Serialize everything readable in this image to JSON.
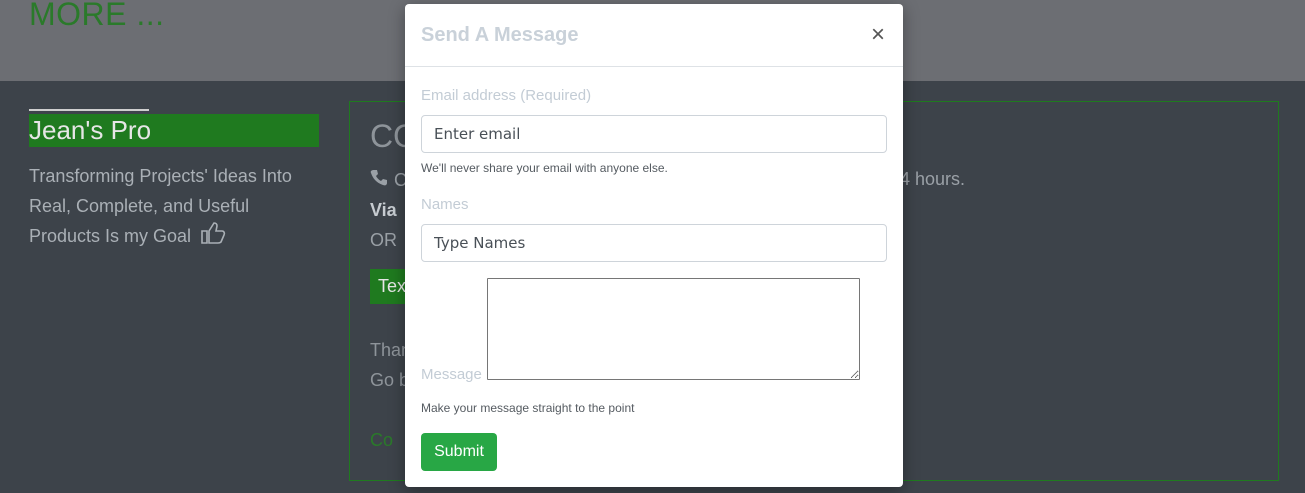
{
  "background": {
    "more_title": "MORE ...",
    "profile": {
      "name": "Jean's Pro",
      "tagline": "Transforming Projects' Ideas Into Real, Complete, and Useful Products Is my Goal"
    },
    "contact": {
      "heading": "CO",
      "line_start": "C",
      "line_end": "4 hours.",
      "via": "Via",
      "or": "OR",
      "text_button": "Tex",
      "thanks": "Than",
      "goback": "Go b",
      "link": "Co"
    }
  },
  "modal": {
    "title": "Send A Message",
    "close_symbol": "×",
    "email": {
      "label": "Email address (Required)",
      "placeholder": "Enter email",
      "help": "We'll never share your email with anyone else."
    },
    "names": {
      "label": "Names",
      "placeholder": "Type Names"
    },
    "message": {
      "label": "Message",
      "help": "Make your message straight to the point"
    },
    "submit_label": "Submit"
  },
  "colors": {
    "accent_green": "#1f7a1f",
    "submit_green": "#28a745"
  },
  "icons": [
    "thumbs-up-icon",
    "phone-icon",
    "close-icon"
  ]
}
